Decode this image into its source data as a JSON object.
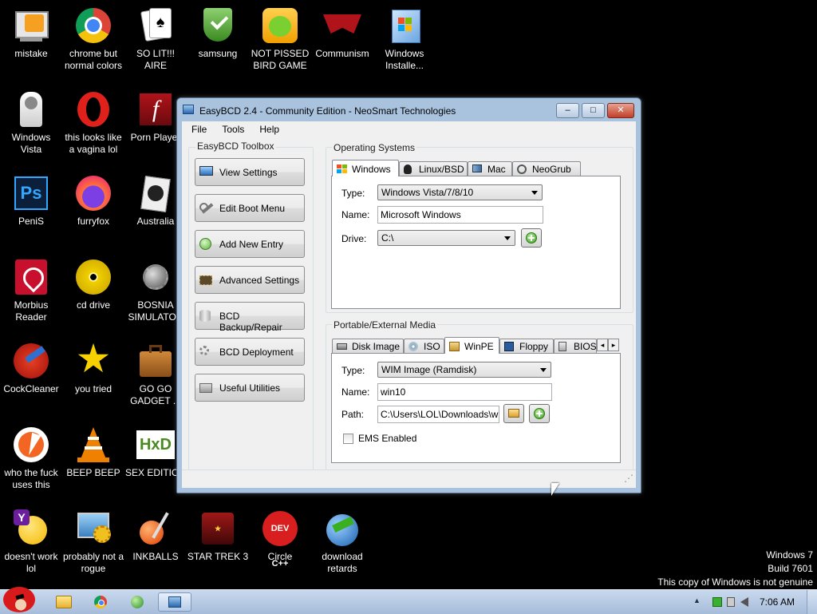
{
  "desktop": {
    "icons": [
      {
        "label": "mistake"
      },
      {
        "label": "chrome but normal colors"
      },
      {
        "label": "SO LIT!!! AIRE"
      },
      {
        "label": "samsung"
      },
      {
        "label": "NOT PISSED BIRD GAME"
      },
      {
        "label": "Communism"
      },
      {
        "label": "Windows Installe..."
      },
      {
        "label": "Windows Vista"
      },
      {
        "label": "this looks like a vagina lol"
      },
      {
        "label": "Porn Player"
      },
      {
        "label": "PeniS"
      },
      {
        "label": "furryfox"
      },
      {
        "label": "Australia"
      },
      {
        "label": "Morbius Reader"
      },
      {
        "label": "cd drive"
      },
      {
        "label": "BOSNIA SIMULATOR"
      },
      {
        "label": "CockCleaner"
      },
      {
        "label": "you tried"
      },
      {
        "label": "GO GO GADGET ..."
      },
      {
        "label": "who the fuck uses this"
      },
      {
        "label": "BEEP BEEP"
      },
      {
        "label": "SEX EDITION"
      },
      {
        "label": "doesn't work lol"
      },
      {
        "label": "probably not a rogue"
      },
      {
        "label": "INKBALLS"
      },
      {
        "label": "STAR TREK 3"
      },
      {
        "label": "Circle"
      },
      {
        "label": "download retards"
      }
    ],
    "icon_glyphs": {
      "photoshop": "Ps",
      "devcpp": "DEV C++",
      "hxd": "HxD",
      "flash": "f"
    }
  },
  "window": {
    "title": "EasyBCD 2.4 - Community Edition - NeoSmart Technologies",
    "controls": {
      "minimize": "–",
      "maximize": "□",
      "close": "✕"
    },
    "menu": [
      "File",
      "Tools",
      "Help"
    ],
    "toolbox": {
      "title": "EasyBCD Toolbox",
      "buttons": [
        "View Settings",
        "Edit Boot Menu",
        "Add New Entry",
        "Advanced Settings",
        "BCD Backup/Repair",
        "BCD Deployment",
        "Useful Utilities"
      ]
    },
    "os": {
      "title": "Operating Systems",
      "tabs": [
        "Windows",
        "Linux/BSD",
        "Mac",
        "NeoGrub"
      ],
      "type_label": "Type:",
      "type_value": "Windows Vista/7/8/10",
      "name_label": "Name:",
      "name_value": "Microsoft Windows",
      "drive_label": "Drive:",
      "drive_value": "C:\\"
    },
    "media": {
      "title": "Portable/External Media",
      "tabs": [
        "Disk Image",
        "ISO",
        "WinPE",
        "Floppy",
        "BIOS"
      ],
      "scroll_left": "◂",
      "scroll_right": "▸",
      "type_label": "Type:",
      "type_value": "WIM Image (Ramdisk)",
      "name_label": "Name:",
      "name_value": "win10",
      "path_label": "Path:",
      "path_value": "C:\\Users\\LOL\\Downloads\\wir",
      "ems_label": "EMS Enabled"
    },
    "grip": "⋰"
  },
  "watermark": {
    "line1": "Windows 7",
    "line2": "Build 7601",
    "line3": "This copy of Windows is not genuine"
  },
  "taskbar": {
    "clock": "7:06 AM",
    "tray_arrow": "▲"
  }
}
